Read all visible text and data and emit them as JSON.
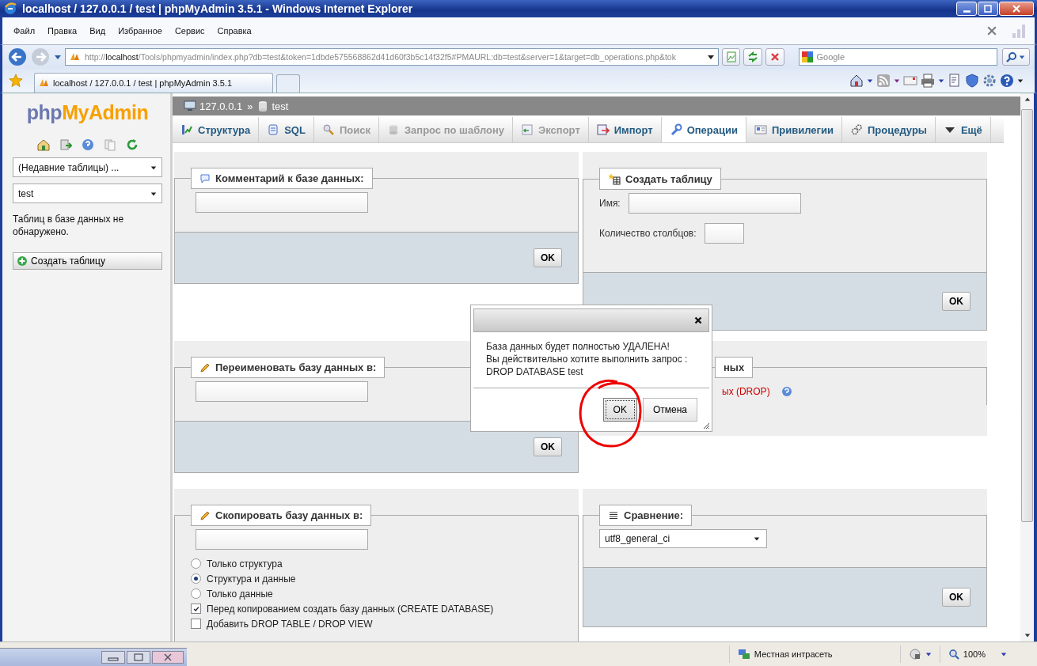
{
  "window": {
    "title": "localhost / 127.0.0.1 / test | phpMyAdmin 3.5.1 - Windows Internet Explorer"
  },
  "menu": [
    "Файл",
    "Правка",
    "Вид",
    "Избранное",
    "Сервис",
    "Справка"
  ],
  "address": {
    "scheme": "http://",
    "host": "localhost",
    "rest": "/Tools/phpmyadmin/index.php?db=test&token=1dbde575568862d41d60f3b5c14f32f5#PMAURL:db=test&server=1&target=db_operations.php&tok"
  },
  "search": {
    "placeholder": "Google"
  },
  "browser_tabs": [
    {
      "label": "localhost / 127.0.0.1 / test | phpMyAdmin 3.5.1",
      "selected": true
    }
  ],
  "sidebar": {
    "logo_php": "php",
    "logo_rest": "MyAdmin",
    "recent": "(Недавние таблицы) ...",
    "database": "test",
    "message": "Таблиц в базе данных не обнаружено.",
    "create_button": "Создать таблицу"
  },
  "breadcrumb": {
    "server": "127.0.0.1",
    "separator": "»",
    "database": "test"
  },
  "tabs": [
    {
      "label": "Структура",
      "disabled": false,
      "selected": false
    },
    {
      "label": "SQL",
      "disabled": false,
      "selected": false
    },
    {
      "label": "Поиск",
      "disabled": true,
      "selected": false
    },
    {
      "label": "Запрос по шаблону",
      "disabled": true,
      "selected": false
    },
    {
      "label": "Экспорт",
      "disabled": true,
      "selected": false
    },
    {
      "label": "Импорт",
      "disabled": false,
      "selected": false
    },
    {
      "label": "Операции",
      "disabled": false,
      "selected": true
    },
    {
      "label": "Привилегии",
      "disabled": false,
      "selected": false
    },
    {
      "label": "Процедуры",
      "disabled": false,
      "selected": false
    },
    {
      "label": "Ещё",
      "disabled": false,
      "selected": false
    }
  ],
  "comment_panel": {
    "legend": "Комментарий к базе данных:",
    "button": "OK"
  },
  "create_table_panel": {
    "legend": "Создать таблицу",
    "name_label": "Имя:",
    "columns_label": "Количество столбцов:",
    "button": "OK"
  },
  "rename_panel": {
    "legend": "Переименовать базу данных в:",
    "button": "OK"
  },
  "drop_panel": {
    "legend": "ных",
    "link": "ых (DROP)"
  },
  "copy_panel": {
    "legend": "Скопировать базу данных в:",
    "options": [
      {
        "kind": "radio",
        "label": "Только структура",
        "checked": false
      },
      {
        "kind": "radio",
        "label": "Структура и данные",
        "checked": true
      },
      {
        "kind": "radio",
        "label": "Только данные",
        "checked": false
      },
      {
        "kind": "checkbox",
        "label": "Перед копированием создать базу данных (CREATE DATABASE)",
        "checked": true
      },
      {
        "kind": "checkbox",
        "label": "Добавить DROP TABLE / DROP VIEW",
        "checked": false
      }
    ]
  },
  "collation_panel": {
    "legend": "Сравнение:",
    "value": "utf8_general_ci",
    "button": "OK"
  },
  "dialog": {
    "lines": [
      "База данных будет полностью УДАЛЕНА!",
      "Вы действительно хотите выполнить запрос :",
      "DROP DATABASE test"
    ],
    "buttons": [
      "OK",
      "Отмена"
    ]
  },
  "status_bar": {
    "zone": "Местная интрасеть",
    "zoom": "100%"
  }
}
